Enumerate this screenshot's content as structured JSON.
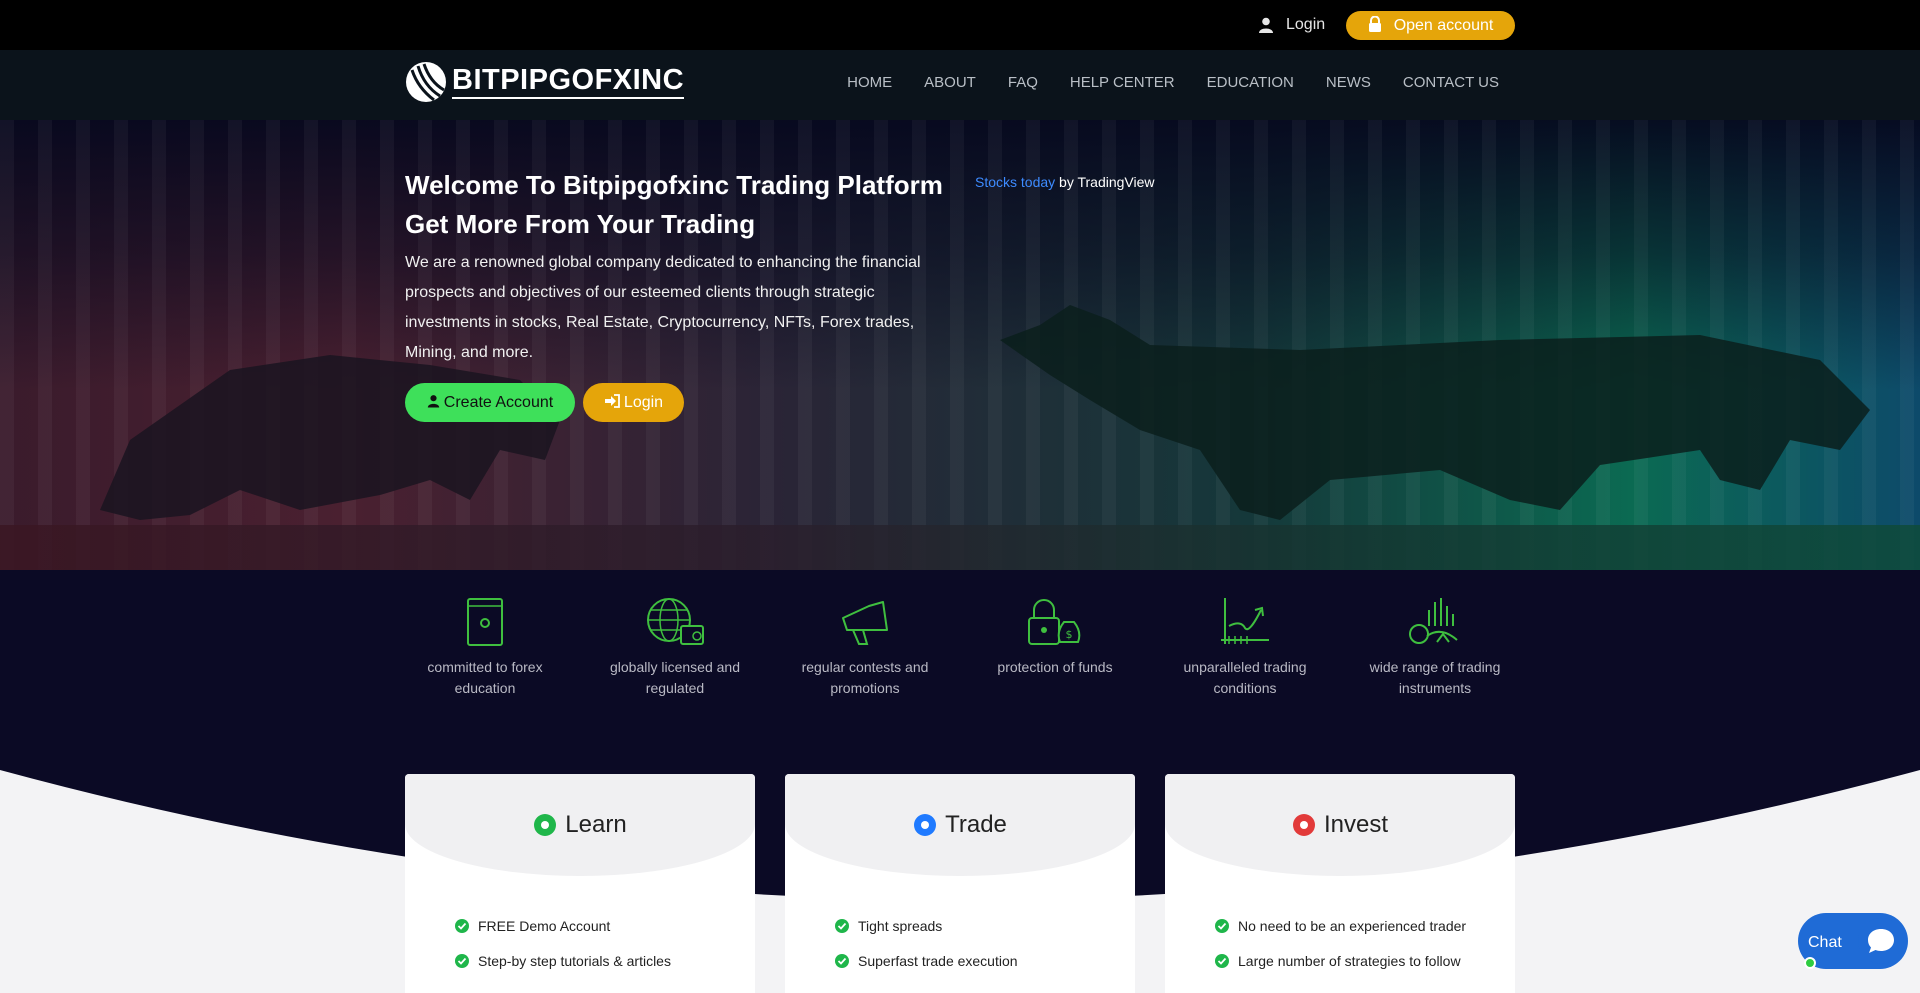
{
  "topbar": {
    "login_label": "Login",
    "open_account_label": "Open account"
  },
  "brand": {
    "logo_text": "BITPIPGOFXINC"
  },
  "nav": {
    "items": [
      "HOME",
      "ABOUT",
      "FAQ",
      "HELP CENTER",
      "EDUCATION",
      "NEWS",
      "CONTACT US"
    ]
  },
  "hero": {
    "title_line1": "Welcome To Bitpipgofxinc Trading Platform",
    "title_line2": "Get More From Your Trading",
    "description": "We are a renowned global company dedicated to enhancing the financial prospects and objectives of our esteemed clients through strategic investments in stocks, Real Estate, Cryptocurrency, NFTs, Forex trades, Mining, and more.",
    "create_account_label": "Create Account",
    "login_label": "Login"
  },
  "tradingview": {
    "link_text": "Stocks today",
    "suffix_text": " by TradingView"
  },
  "features": [
    {
      "label": "committed to forex education",
      "icon": "book-icon"
    },
    {
      "label": "globally licensed and regulated",
      "icon": "globe-certificate-icon"
    },
    {
      "label": "regular contests and promotions",
      "icon": "megaphone-icon"
    },
    {
      "label": "protection of funds",
      "icon": "lock-money-icon"
    },
    {
      "label": "unparalleled trading conditions",
      "icon": "growth-chart-icon"
    },
    {
      "label": "wide range of trading instruments",
      "icon": "instruments-icon"
    }
  ],
  "cards": [
    {
      "title": "Learn",
      "dot_color": "#1fb64a",
      "items": [
        "FREE Demo Account",
        "Step-by step tutorials & articles"
      ]
    },
    {
      "title": "Trade",
      "dot_color": "#1f7aff",
      "items": [
        "Tight spreads",
        "Superfast trade execution"
      ]
    },
    {
      "title": "Invest",
      "dot_color": "#e23a3a",
      "items": [
        "No need to be an experienced trader",
        "Large number of strategies to follow"
      ]
    }
  ],
  "chat": {
    "label": "Chat"
  },
  "colors": {
    "accent_gold": "#e5a50a",
    "accent_green": "#3ee05a",
    "feature_icon": "#3fbf3f",
    "check_green": "#1fb64a",
    "chat_blue": "#1f6bd6"
  }
}
